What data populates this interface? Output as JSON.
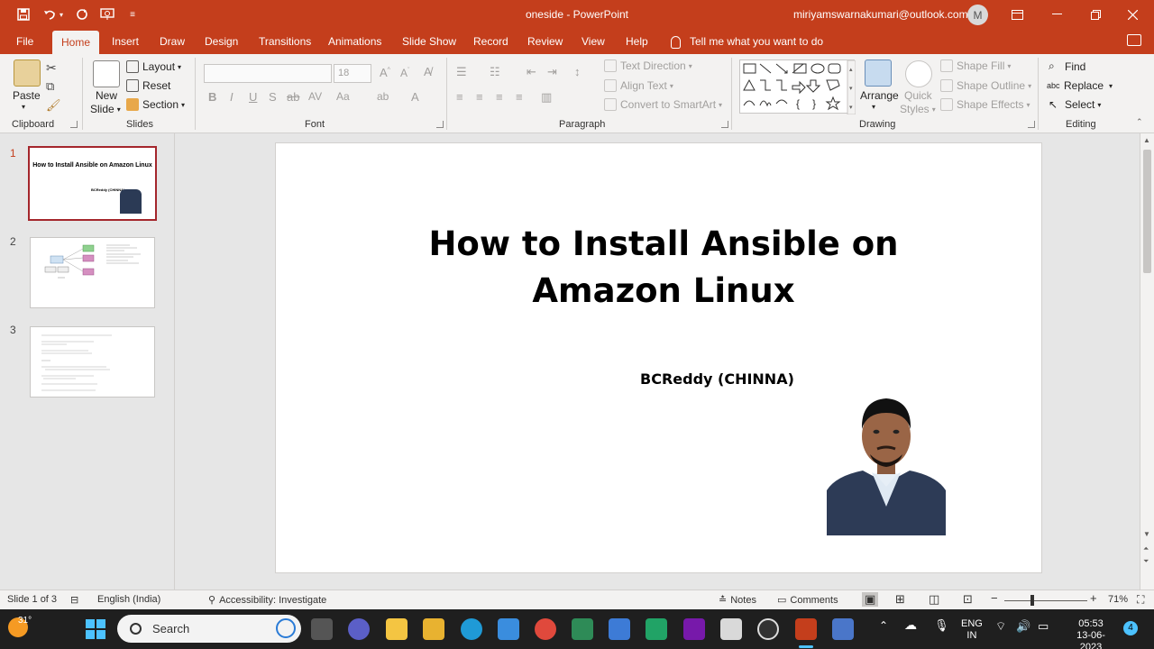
{
  "window": {
    "title": "oneside  -  PowerPoint",
    "account": "miriyamswarnakumari@outlook.com",
    "avatar_initial": "M"
  },
  "quick_access": {
    "save": "save-icon",
    "undo": "undo-icon",
    "redo": "redo-icon",
    "present": "present-icon",
    "customize": "customize-icon"
  },
  "tabs": {
    "file": "File",
    "home": "Home",
    "insert": "Insert",
    "draw": "Draw",
    "design": "Design",
    "transitions": "Transitions",
    "animations": "Animations",
    "slideshow": "Slide Show",
    "record": "Record",
    "review": "Review",
    "view": "View",
    "help": "Help",
    "tellme": "Tell me what you want to do"
  },
  "ribbon": {
    "clipboard": {
      "label": "Clipboard",
      "paste": "Paste"
    },
    "slides": {
      "label": "Slides",
      "new1": "New",
      "new2": "Slide",
      "layout": "Layout",
      "reset": "Reset",
      "section": "Section"
    },
    "font": {
      "label": "Font",
      "size": "18"
    },
    "paragraph": {
      "label": "Paragraph",
      "text_direction": "Text Direction",
      "align_text": "Align Text",
      "convert": "Convert to SmartArt"
    },
    "drawing": {
      "label": "Drawing",
      "arrange": "Arrange",
      "quick1": "Quick",
      "quick2": "Styles",
      "shape_fill": "Shape Fill",
      "shape_outline": "Shape Outline",
      "shape_effects": "Shape Effects"
    },
    "editing": {
      "label": "Editing",
      "find": "Find",
      "replace": "Replace",
      "select": "Select"
    }
  },
  "thumbnails": [
    {
      "num": "1",
      "title": "How to Install Ansible on Amazon Linux",
      "sub": "BCReddy (CHINNA)"
    },
    {
      "num": "2"
    },
    {
      "num": "3"
    }
  ],
  "slide": {
    "title_line1": "How to Install Ansible on",
    "title_line2": "Amazon Linux",
    "subtitle": "BCReddy (CHINNA)"
  },
  "status": {
    "slide_count": "Slide 1 of 3",
    "language": "English (India)",
    "accessibility": "Accessibility: Investigate",
    "notes": "Notes",
    "comments": "Comments",
    "zoom": "71%"
  },
  "taskbar": {
    "weather": "31°",
    "search": "Search",
    "lang1": "ENG",
    "lang2": "IN",
    "time": "05:53",
    "date": "13-06-2023",
    "notif_count": "4"
  }
}
